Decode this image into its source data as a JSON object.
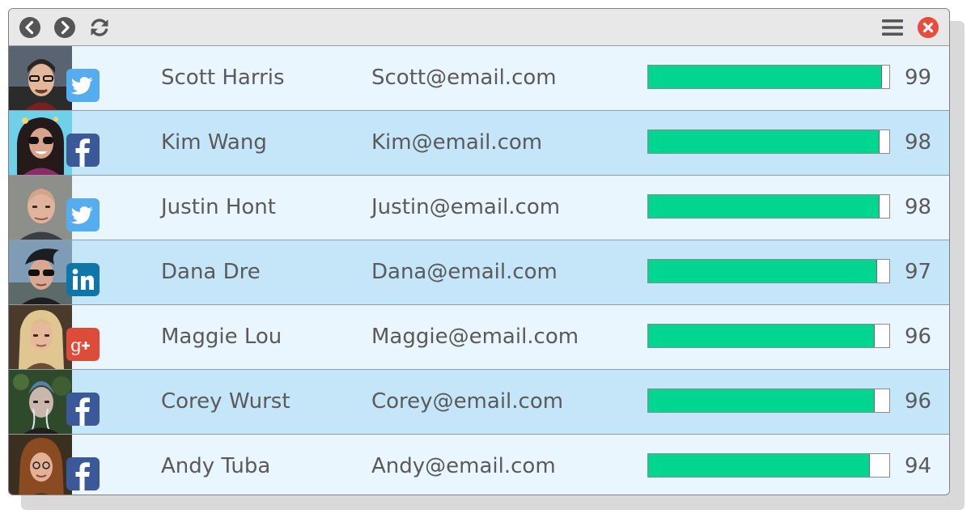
{
  "colors": {
    "row_light": "#eaf6fe",
    "row_dark": "#c5e6f9",
    "bar_fill": "#00d68f",
    "twitter": "#55acee",
    "facebook": "#3b5998",
    "linkedin": "#0e76a8",
    "google_plus": "#dd4b39",
    "close": "#e74c3c"
  },
  "toolbar": {
    "back_icon": "chevron-left-circle",
    "forward_icon": "chevron-right-circle",
    "refresh_icon": "refresh",
    "menu_icon": "hamburger-menu",
    "close_icon": "close-circle"
  },
  "contacts": [
    {
      "name": "Scott Harris",
      "email": "Scott@email.com",
      "score": "99",
      "progress": 0.97,
      "network": "twitter"
    },
    {
      "name": "Kim Wang",
      "email": "Kim@email.com",
      "score": "98",
      "progress": 0.96,
      "network": "facebook"
    },
    {
      "name": "Justin Hont",
      "email": "Justin@email.com",
      "score": "98",
      "progress": 0.96,
      "network": "twitter"
    },
    {
      "name": "Dana Dre",
      "email": "Dana@email.com",
      "score": "97",
      "progress": 0.95,
      "network": "linkedin"
    },
    {
      "name": "Maggie Lou",
      "email": "Maggie@email.com",
      "score": "96",
      "progress": 0.94,
      "network": "google-plus"
    },
    {
      "name": "Corey Wurst",
      "email": "Corey@email.com",
      "score": "96",
      "progress": 0.94,
      "network": "facebook"
    },
    {
      "name": "Andy Tuba",
      "email": "Andy@email.com",
      "score": "94",
      "progress": 0.92,
      "network": "facebook"
    }
  ]
}
